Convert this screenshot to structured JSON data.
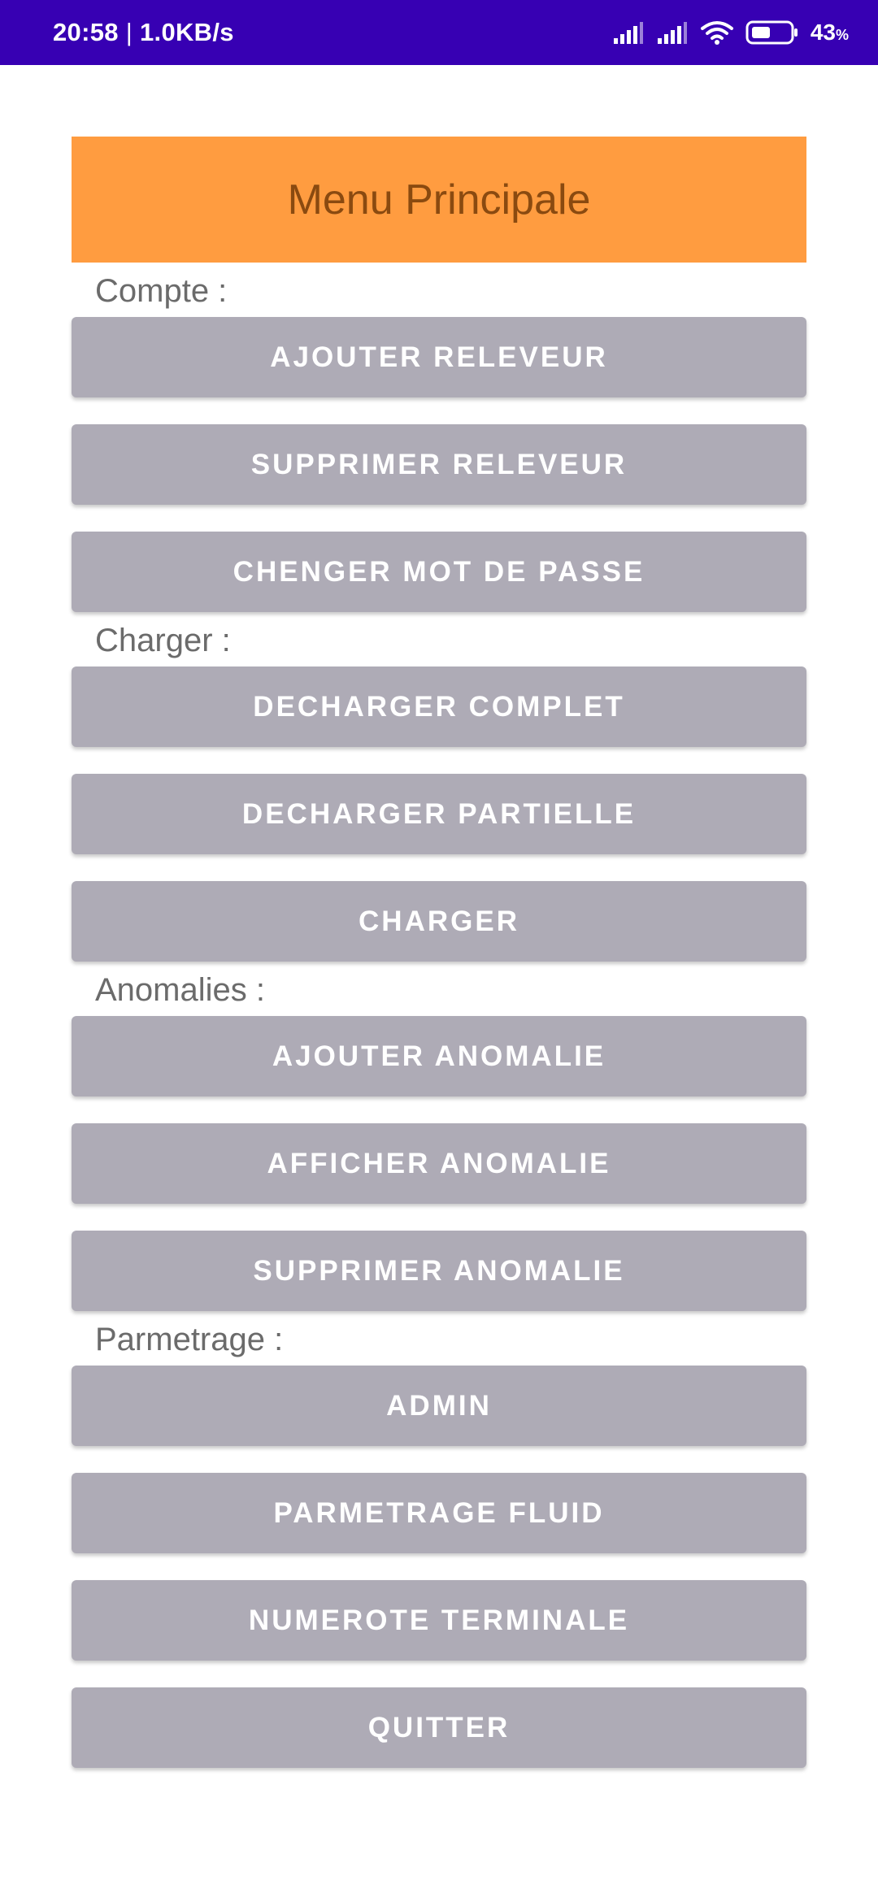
{
  "status_bar": {
    "time": "20:58",
    "speed": "1.0KB/s",
    "battery_percent": "43",
    "battery_unit": "%",
    "icons": [
      "signal-icon",
      "signal-icon",
      "wifi-icon",
      "battery-icon"
    ],
    "background": "#3700b3"
  },
  "header": {
    "title": "Menu Principale",
    "color": "#ff9c40"
  },
  "sections": {
    "compte": {
      "label": "Compte :",
      "buttons": [
        "AJOUTER RELEVEUR",
        "SUPPRIMER RELEVEUR",
        "CHENGER MOT DE PASSE"
      ]
    },
    "charger": {
      "label": "Charger :",
      "buttons": [
        "DECHARGER COMPLET",
        "DECHARGER PARTIELLE",
        "CHARGER"
      ]
    },
    "anomalies": {
      "label": "Anomalies :",
      "buttons": [
        "AJOUTER ANOMALIE",
        "AFFICHER ANOMALIE",
        "SUPPRIMER ANOMALIE"
      ]
    },
    "parmetrage": {
      "label": "Parmetrage :",
      "buttons": [
        "ADMIN",
        "PARMETRAGE FLUID",
        "NUMEROTE TERMINALE",
        "QUITTER"
      ]
    }
  },
  "button_color": "#aeabb6"
}
